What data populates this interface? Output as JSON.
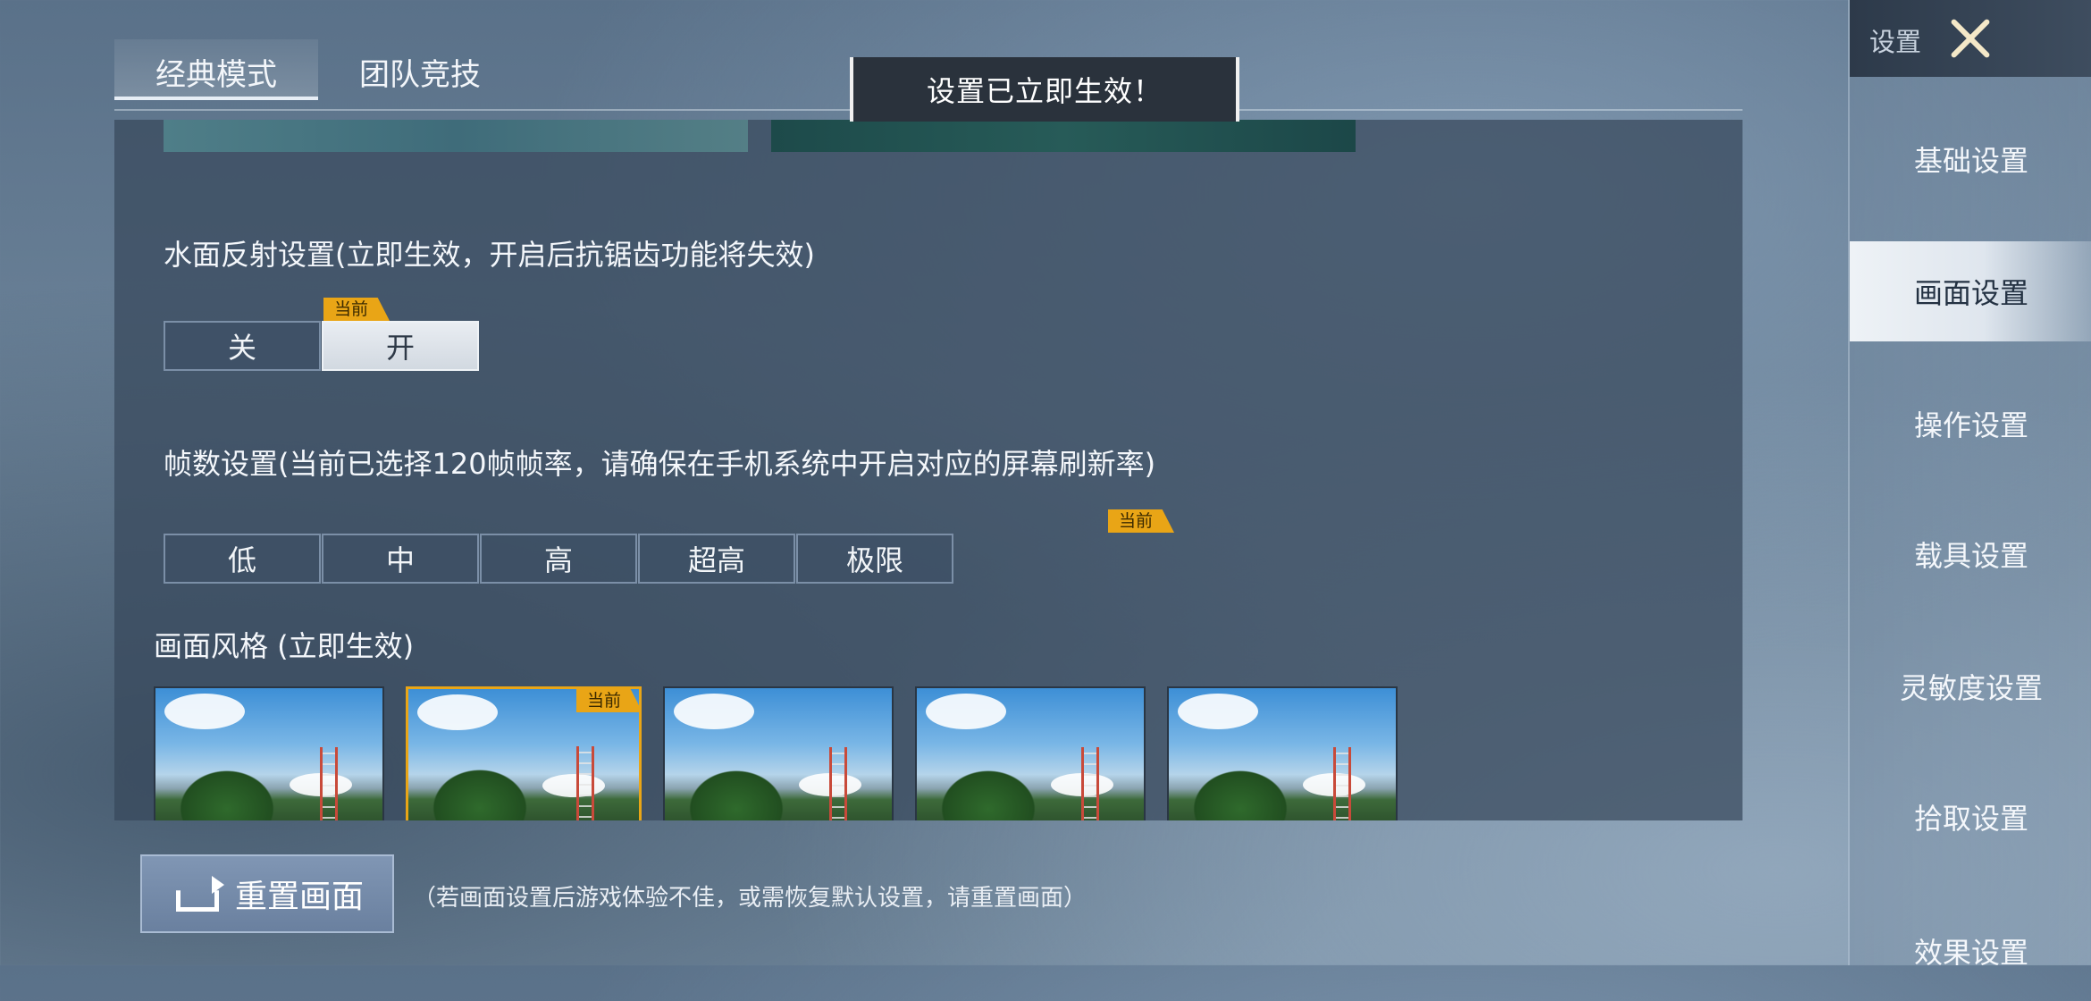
{
  "tabs": [
    {
      "label": "经典模式",
      "active": true
    },
    {
      "label": "团队竞技",
      "active": false
    }
  ],
  "toast": {
    "text": "设置已立即生效！"
  },
  "water_reflection": {
    "label": "水面反射设置(立即生效，开启后抗锯齿功能将失效)",
    "options": [
      "关",
      "开"
    ],
    "selected": "开",
    "badge": "当前"
  },
  "frame_rate": {
    "label": "帧数设置(当前已选择120帧帧率，请确保在手机系统中开启对应的屏幕刷新率)",
    "options": [
      "低",
      "中",
      "高",
      "超高",
      "极限"
    ],
    "badge": "当前"
  },
  "graphics_style": {
    "label": "画面风格 (立即生效)",
    "badge": "当前",
    "current_index": 1
  },
  "reset": {
    "button_label": "重置画面",
    "note": "（若画面设置后游戏体验不佳，或需恢复默认设置，请重置画面）"
  },
  "sidebar": {
    "title": "设置",
    "items": [
      {
        "label": "基础设置",
        "active": false
      },
      {
        "label": "画面设置",
        "active": true
      },
      {
        "label": "操作设置",
        "active": false
      },
      {
        "label": "载具设置",
        "active": false
      },
      {
        "label": "灵敏度设置",
        "active": false
      },
      {
        "label": "拾取设置",
        "active": false
      },
      {
        "label": "效果设置",
        "active": false
      }
    ]
  },
  "colors": {
    "accent_badge": "#e9a516",
    "panel": "#38485c",
    "selected_button": "#e9edf2"
  }
}
